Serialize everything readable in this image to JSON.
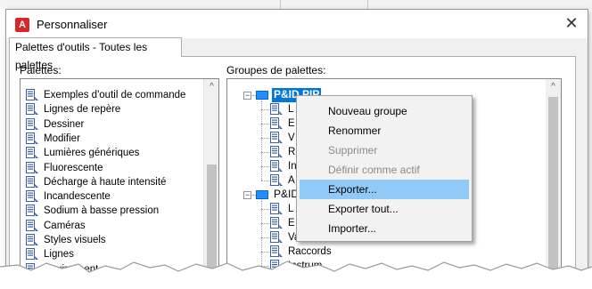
{
  "window": {
    "title": "Personnaliser",
    "close_glyph": "✕",
    "app_icon_letter": "A"
  },
  "tab": {
    "label": "Palettes d'outils - Toutes les palettes"
  },
  "palettes": {
    "label": "Palettes:",
    "items": [
      "Exemples d'outil de commande",
      "Lignes de repère",
      "Dessiner",
      "Modifier",
      "Lumières génériques",
      "Fluorescente",
      "Décharge à haute intensité",
      "Incandescente",
      "Sodium à basse pression",
      "Caméras",
      "Styles visuels",
      "Lignes",
      "Equipement"
    ]
  },
  "groups": {
    "label": "Groupes de palettes:",
    "group1": {
      "name": "P&ID PIP",
      "children": [
        "L",
        "E",
        "V",
        "R",
        "In",
        "A"
      ]
    },
    "group2": {
      "name": "P&ID",
      "children": [
        "L",
        "E",
        "Vannes",
        "Raccords",
        "Instrum"
      ]
    }
  },
  "context_menu": {
    "items": [
      {
        "label": "Nouveau groupe",
        "enabled": true,
        "hover": false
      },
      {
        "label": "Renommer",
        "enabled": true,
        "hover": false
      },
      {
        "label": "Supprimer",
        "enabled": false,
        "hover": false
      },
      {
        "label": "Définir comme actif",
        "enabled": false,
        "hover": false
      },
      {
        "label": "Exporter...",
        "enabled": true,
        "hover": true
      },
      {
        "label": "Exporter tout...",
        "enabled": true,
        "hover": false
      },
      {
        "label": "Importer...",
        "enabled": true,
        "hover": false
      }
    ]
  },
  "icons": {
    "palette_item": "palette-tool-icon",
    "group_folder": "blue-folder-icon",
    "expander": "tree-collapse-icon",
    "scroll_up": "scroll-up-arrow-icon",
    "close": "close-icon"
  },
  "colors": {
    "selection": "#0078d7",
    "menu_hover": "#91c9f7",
    "app_icon": "#d9262b",
    "folder": "#1e90ff"
  }
}
